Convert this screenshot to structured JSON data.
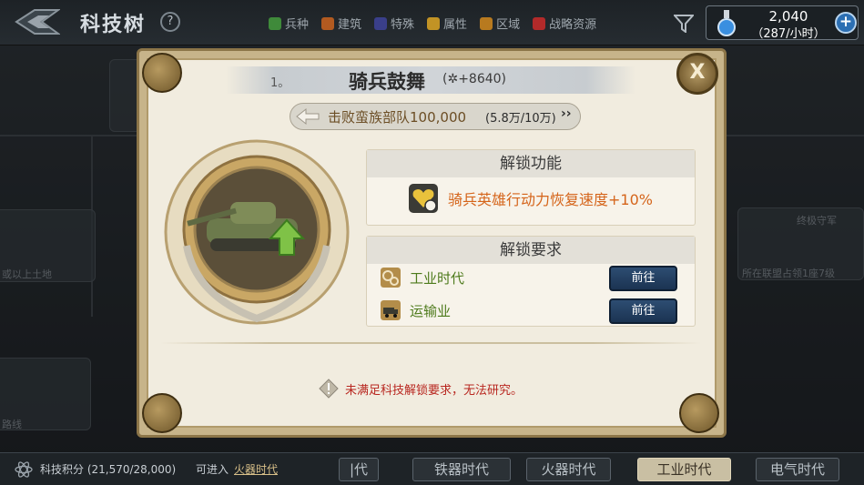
{
  "topbar": {
    "title": "科技树",
    "help": "?",
    "filters": [
      {
        "label": "兵种",
        "color": "#3f8a3a"
      },
      {
        "label": "建筑",
        "color": "#b25a20"
      },
      {
        "label": "特殊",
        "color": "#3a3f8a"
      },
      {
        "label": "属性",
        "color": "#c29325"
      },
      {
        "label": "区域",
        "color": "#b87a1f"
      },
      {
        "label": "战略资源",
        "color": "#b22a2a"
      }
    ],
    "resource": {
      "value": "2,040",
      "rate": "（287/小时）",
      "plus": "+"
    }
  },
  "modal": {
    "level": "1。",
    "name": "骑兵鼓舞",
    "points": "(✲+8640)",
    "goal": {
      "text": "击败蛮族部队100,000",
      "progress": "(5.8万/10万)",
      "more": "››"
    },
    "close": "X",
    "unlock_function": {
      "title": "解锁功能",
      "text": "骑兵英雄行动力恢复速度+10%"
    },
    "unlock_requirements": {
      "title": "解锁要求",
      "items": [
        {
          "label": "工业时代",
          "button": "前往"
        },
        {
          "label": "运输业",
          "button": "前往"
        }
      ]
    },
    "warning": "未满足科技解锁要求，无法研究。"
  },
  "bottombar": {
    "points": "科技积分 (21,570/28,000)",
    "hint": "可进入",
    "link": "火器时代",
    "eras": [
      "|代",
      "铁器时代",
      "火器时代",
      "工业时代",
      "电气时代"
    ],
    "active_era": "工业时代"
  },
  "background": {
    "left_text_1": "或以上土地",
    "left_text_2": "路线",
    "right_title": "终极守军",
    "right_text": "所在联盟占领1座7级"
  }
}
